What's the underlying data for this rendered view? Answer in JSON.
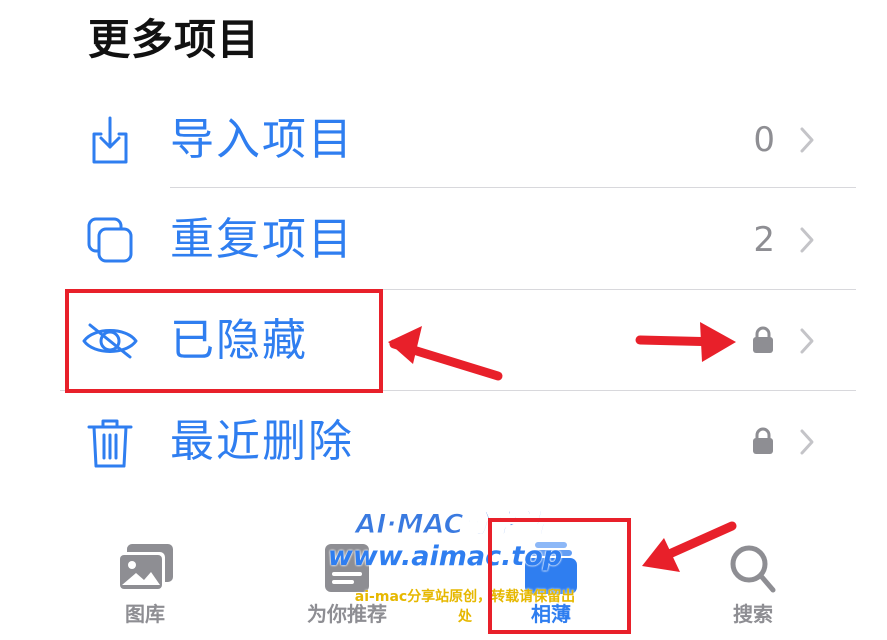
{
  "section": {
    "title": "更多项目"
  },
  "rows": [
    {
      "label": "导入项目",
      "count": "0",
      "icon": "import-icon",
      "locked": false
    },
    {
      "label": "重复项目",
      "count": "2",
      "icon": "duplicate-icon",
      "locked": false
    },
    {
      "label": "已隐藏",
      "count": "",
      "icon": "eye-slash-icon",
      "locked": true
    },
    {
      "label": "最近删除",
      "count": "",
      "icon": "trash-icon",
      "locked": true
    }
  ],
  "tabbar": {
    "tabs": [
      {
        "label": "图库",
        "icon": "library-icon",
        "active": false
      },
      {
        "label": "为你推荐",
        "icon": "for-you-icon",
        "active": false
      },
      {
        "label": "相薄",
        "icon": "albums-icon",
        "active": true
      },
      {
        "label": "搜索",
        "icon": "search-icon",
        "active": false
      }
    ]
  },
  "watermark": {
    "line1": "AI·MAC分享站",
    "line2": "www.aimac.top",
    "line3": "ai-mac分享站原创，转载请保留出处"
  },
  "colors": {
    "accent": "#2f7ef0",
    "secondary_text": "#8e8e93",
    "annotation_red": "#e8202a",
    "watermark_yellow": "#e6b800"
  }
}
